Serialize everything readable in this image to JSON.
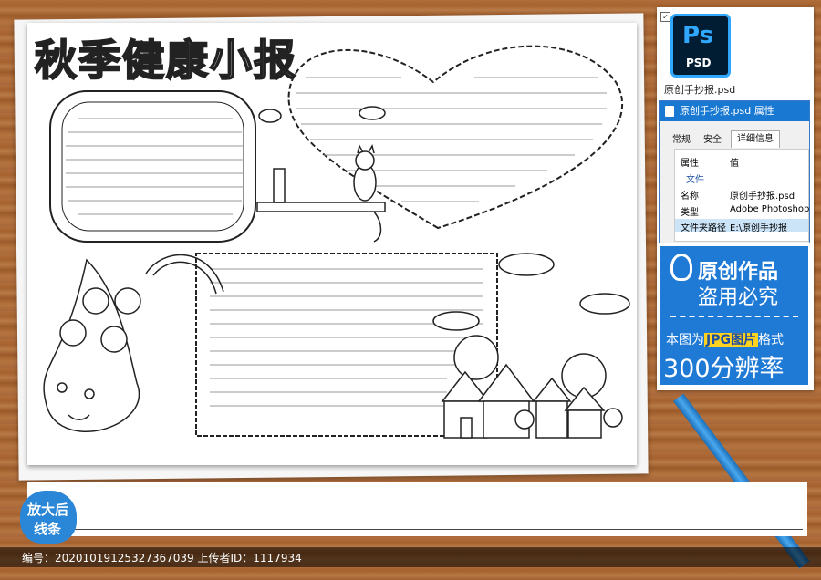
{
  "page": {
    "title": "秋季健康小报"
  },
  "file": {
    "icon_label": "Ps",
    "icon_sub": "PSD",
    "caption": "原创手抄报.psd"
  },
  "properties_window": {
    "title": "原创手抄报.psd 属性",
    "tabs": [
      "常规",
      "安全",
      "详细信息"
    ],
    "active_tab": "详细信息",
    "header": {
      "key": "属性",
      "value": "值"
    },
    "section": "文件",
    "rows": [
      {
        "key": "名称",
        "value": "原创手抄报.psd"
      },
      {
        "key": "类型",
        "value": "Adobe Photoshop"
      },
      {
        "key": "文件夹路径",
        "value": "E:\\原创手抄报"
      }
    ]
  },
  "notice": {
    "line1": "原创作品",
    "line2": "盗用必究",
    "format_prefix": "本图为",
    "format_highlight": "JPG图片",
    "format_suffix": "格式",
    "resolution": "300分辨率"
  },
  "badge": {
    "line1": "放大后",
    "line2": "线条"
  },
  "footer": {
    "text": "编号：20201019125327367039 上传者ID：1117934"
  },
  "colors": {
    "wood": "#a8683a",
    "panel_blue": "#1f7ad6",
    "window_title": "#1979d2",
    "highlight": "#ffd21f"
  }
}
